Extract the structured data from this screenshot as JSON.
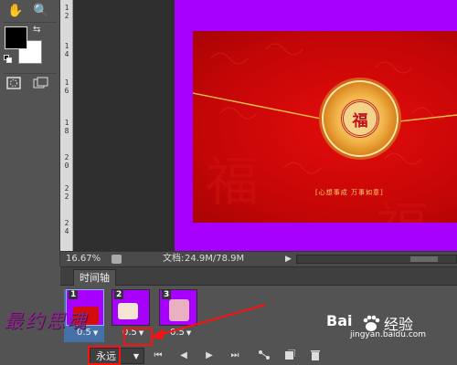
{
  "status_bar": {
    "zoom": "16.67%",
    "doc_label": "文档:",
    "doc_size": "24.9M/78.9M"
  },
  "canvas": {
    "seal_char": "福",
    "blessing": "[心想事成  万事如意]",
    "bg_char": "福"
  },
  "ruler": {
    "numbers": [
      "1",
      "2",
      "1",
      "4",
      "1",
      "6",
      "1",
      "8",
      "2",
      "0",
      "2",
      "2",
      "2",
      "4"
    ]
  },
  "timeline": {
    "tab_label": "时间轴",
    "frames": [
      {
        "number": "1",
        "delay": "0.5",
        "selected": true
      },
      {
        "number": "2",
        "delay": "0.5",
        "selected": false
      },
      {
        "number": "3",
        "delay": "0.5",
        "selected": false
      }
    ],
    "loop_value": "永远"
  },
  "watermark": {
    "signature": "最约思魂",
    "baidu": "Bai",
    "jingyan": "经验",
    "url": "jingyan.baidu.com"
  },
  "colors": {
    "pasteboard": "#a800ff",
    "envelope": "#d80a0a",
    "annotation": "#ff1010"
  }
}
